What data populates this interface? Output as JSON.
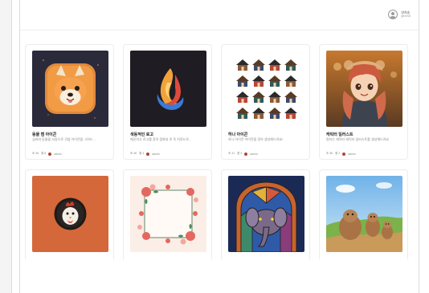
{
  "profile": {
    "name": "방희송",
    "role": "general"
  },
  "cards": [
    {
      "title": "동물 캠 아이콘",
      "desc": "심바와 동물을 사랑으로 귀엽 아이콘을 그려드...",
      "views": "조 46",
      "likes": "좋 8",
      "author": "admin",
      "accent": "#b0453a"
    },
    {
      "title": "색동적인 로고",
      "desc": "깨끗하고 로고를 찾아 점화되 로 옥 치료드로...",
      "views": "조 48",
      "likes": "좋 4",
      "author": "admin",
      "accent": "#b0453a"
    },
    {
      "title": "하나 아이콘",
      "desc": "하나 아이콘 아이콘을 찾아 생성해드려요!",
      "views": "조 41",
      "likes": "좋 3",
      "author": "admin",
      "accent": "#b0453a"
    },
    {
      "title": "캐릭터 일러스트",
      "desc": "원하는 캐릭터 캐릭터 일러스트를 생성해드려요",
      "views": "조 36",
      "likes": "좋 3",
      "author": "admin",
      "accent": "#b0453a"
    },
    {},
    {},
    {},
    {}
  ],
  "colors": {
    "accent": "#b0453a",
    "border": "#ececec"
  }
}
